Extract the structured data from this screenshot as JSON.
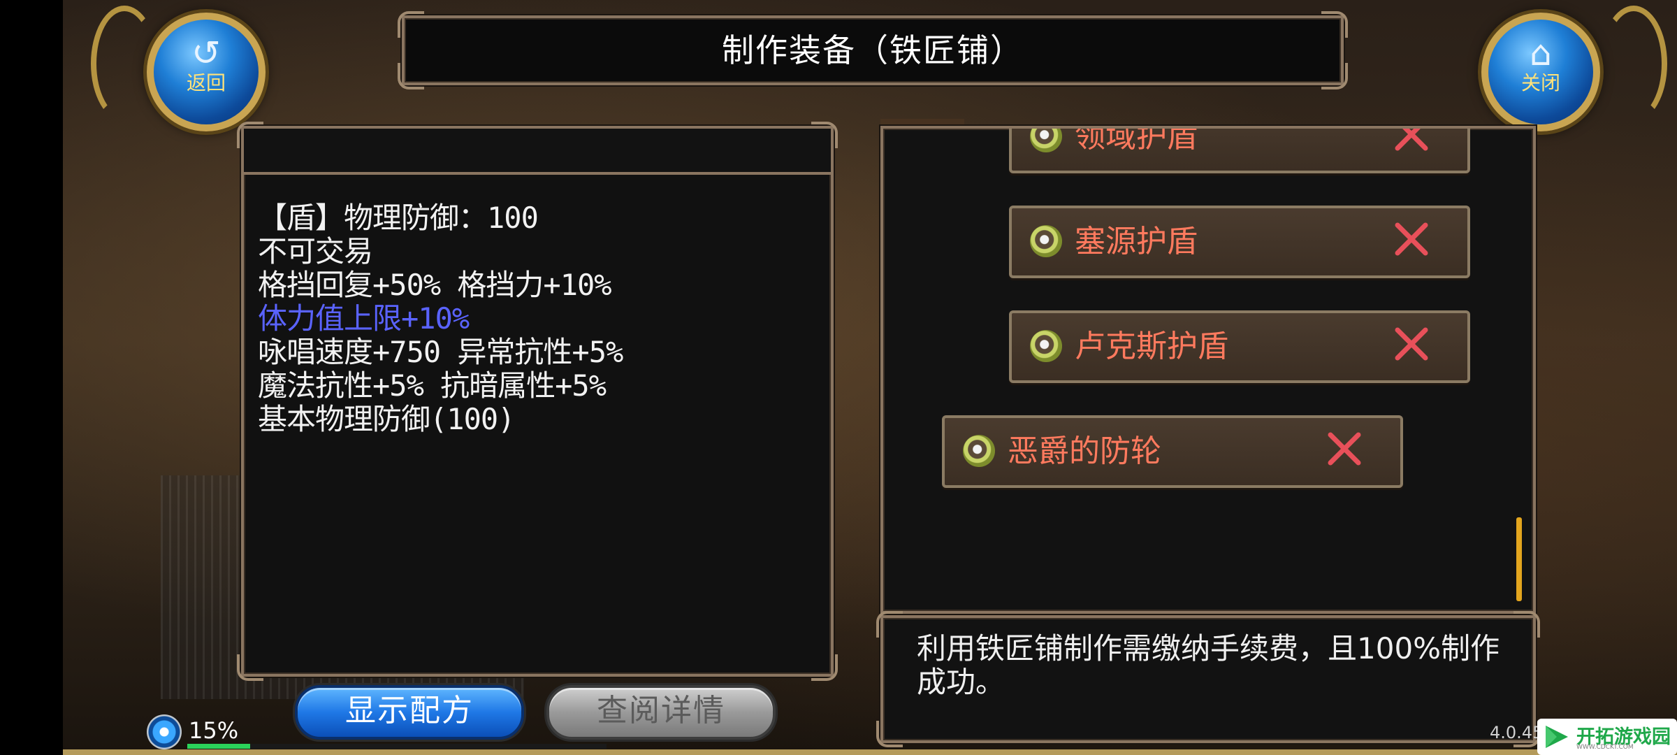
{
  "window": {
    "title": "制作装备（铁匠铺）"
  },
  "nav": {
    "back_label": "返回",
    "back_icon": "return-arrow-icon",
    "close_label": "关闭",
    "close_icon": "home-icon"
  },
  "item_detail": {
    "lines": [
      "【盾】物理防御：100",
      "不可交易",
      "格挡回复+50% 格挡力+10%",
      "体力值上限+10%",
      "咏唱速度+750 异常抗性+5%",
      "魔法抗性+5% 抗暗属性+5%",
      "基本物理防御(100)"
    ],
    "highlight_color": "#5a63ff"
  },
  "recipe_list": {
    "items": [
      {
        "label": "领域护盾",
        "status_icon": "red-x-icon"
      },
      {
        "label": "塞源护盾",
        "status_icon": "red-x-icon"
      },
      {
        "label": "卢克斯护盾",
        "status_icon": "red-x-icon"
      },
      {
        "label": "恶爵的防轮",
        "status_icon": "red-x-icon"
      }
    ],
    "label_color": "#ff7a5e"
  },
  "info": {
    "text": "利用铁匠铺制作需缴纳手续费，且100%制作成功。"
  },
  "buttons": {
    "show_recipe": "显示配方",
    "view_details": "查阅详情"
  },
  "status": {
    "progress_percent": 15,
    "progress_label": "15%",
    "version": "4.0.45"
  },
  "watermark": {
    "name": "开拓游戏园",
    "url": "WWW.CDCKT.COM"
  }
}
